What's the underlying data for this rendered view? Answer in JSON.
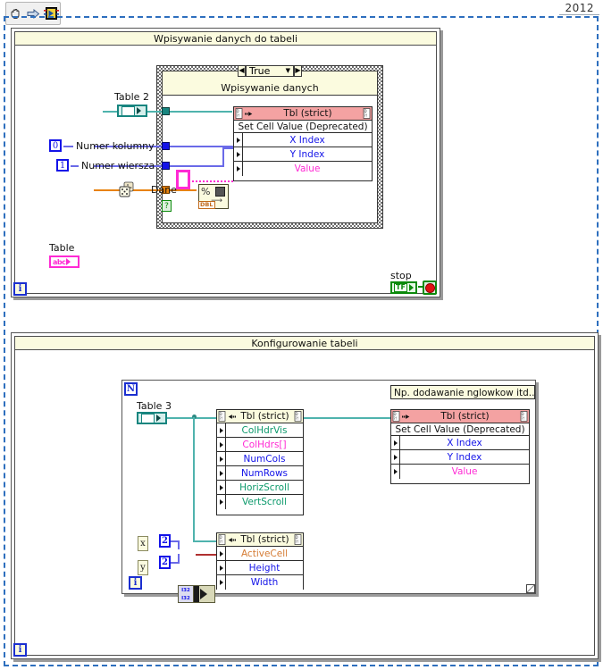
{
  "toolbar": {
    "buttons": [
      {
        "name": "hand-tool",
        "icon": "hand-icon",
        "label": ""
      },
      {
        "name": "arrow-tool",
        "icon": "right-arrow-icon",
        "label": ""
      },
      {
        "name": "vi-icon-tool",
        "icon": "vi-badge-icon",
        "label": ""
      }
    ]
  },
  "outer": {
    "year_tab": "2012"
  },
  "frame1": {
    "title": "Wpisywanie danych do tabeli",
    "loop_index": "i",
    "case": {
      "selector_value": "True",
      "left_arrow": "◀",
      "right_arrow": "▶",
      "dropdown_arrow": "▼",
      "label": "Wpisywanie danych"
    },
    "controls": [
      {
        "name": "table2-reference",
        "label": "Table 2",
        "type": "refnum"
      },
      {
        "name": "numer-kolumny-constant",
        "label": "Numer kolumny",
        "value": "0",
        "type": "integer"
      },
      {
        "name": "numer-wiersza-constant",
        "label": "Numer wiersza",
        "value": "1",
        "type": "integer"
      },
      {
        "name": "dane-random",
        "label": "Dane",
        "type": "random-number"
      }
    ],
    "table_indicator": {
      "label": "Table",
      "type": "string",
      "glyph": "abc"
    },
    "stop": {
      "label": "stop",
      "glyph": "TF"
    },
    "property_node": {
      "title": "Tbl (strict)",
      "method": "Set Cell Value (Deprecated)",
      "rows": [
        {
          "label": "X Index",
          "color": "#1313e8"
        },
        {
          "label": "Y Index",
          "color": "#1313e8"
        },
        {
          "label": "Value",
          "color": "#ff2ad4"
        }
      ]
    },
    "format_node": {
      "glyph": "%",
      "type_tag": "DBL"
    }
  },
  "frame2": {
    "title": "Konfigurowanie tabeli",
    "loop_index": "i",
    "loop_count": "N",
    "inner_loop_index": "i",
    "comment": "Np. dodawanie nglowkow itd...",
    "controls": [
      {
        "name": "table3-reference",
        "label": "Table 3",
        "type": "refnum"
      },
      {
        "name": "x-control",
        "label": "x",
        "value": "2"
      },
      {
        "name": "y-control",
        "label": "y",
        "value": "2"
      }
    ],
    "property_node_1": {
      "title": "Tbl (strict)",
      "rows": [
        {
          "label": "ColHdrVis",
          "color": "#0d9a6c"
        },
        {
          "label": "ColHdrs[]",
          "color": "#ff2ad4"
        },
        {
          "label": "NumCols",
          "color": "#1313e8"
        },
        {
          "label": "NumRows",
          "color": "#1313e8"
        },
        {
          "label": "HorizScroll",
          "color": "#0d9a6c"
        },
        {
          "label": "VertScroll",
          "color": "#0d9a6c"
        }
      ]
    },
    "property_node_2": {
      "title": "Tbl (strict)",
      "rows": [
        {
          "label": "ActiveCell",
          "color": "#d57b33"
        },
        {
          "label": "Height",
          "color": "#1313e8"
        },
        {
          "label": "Width",
          "color": "#1313e8"
        }
      ]
    },
    "property_node_3": {
      "title": "Tbl (strict)",
      "method": "Set Cell Value (Deprecated)",
      "rows": [
        {
          "label": "X Index",
          "color": "#1313e8"
        },
        {
          "label": "Y Index",
          "color": "#1313e8"
        },
        {
          "label": "Value",
          "color": "#ff2ad4"
        }
      ]
    },
    "bundle": {
      "top": "I32",
      "bottom": "I32"
    }
  }
}
